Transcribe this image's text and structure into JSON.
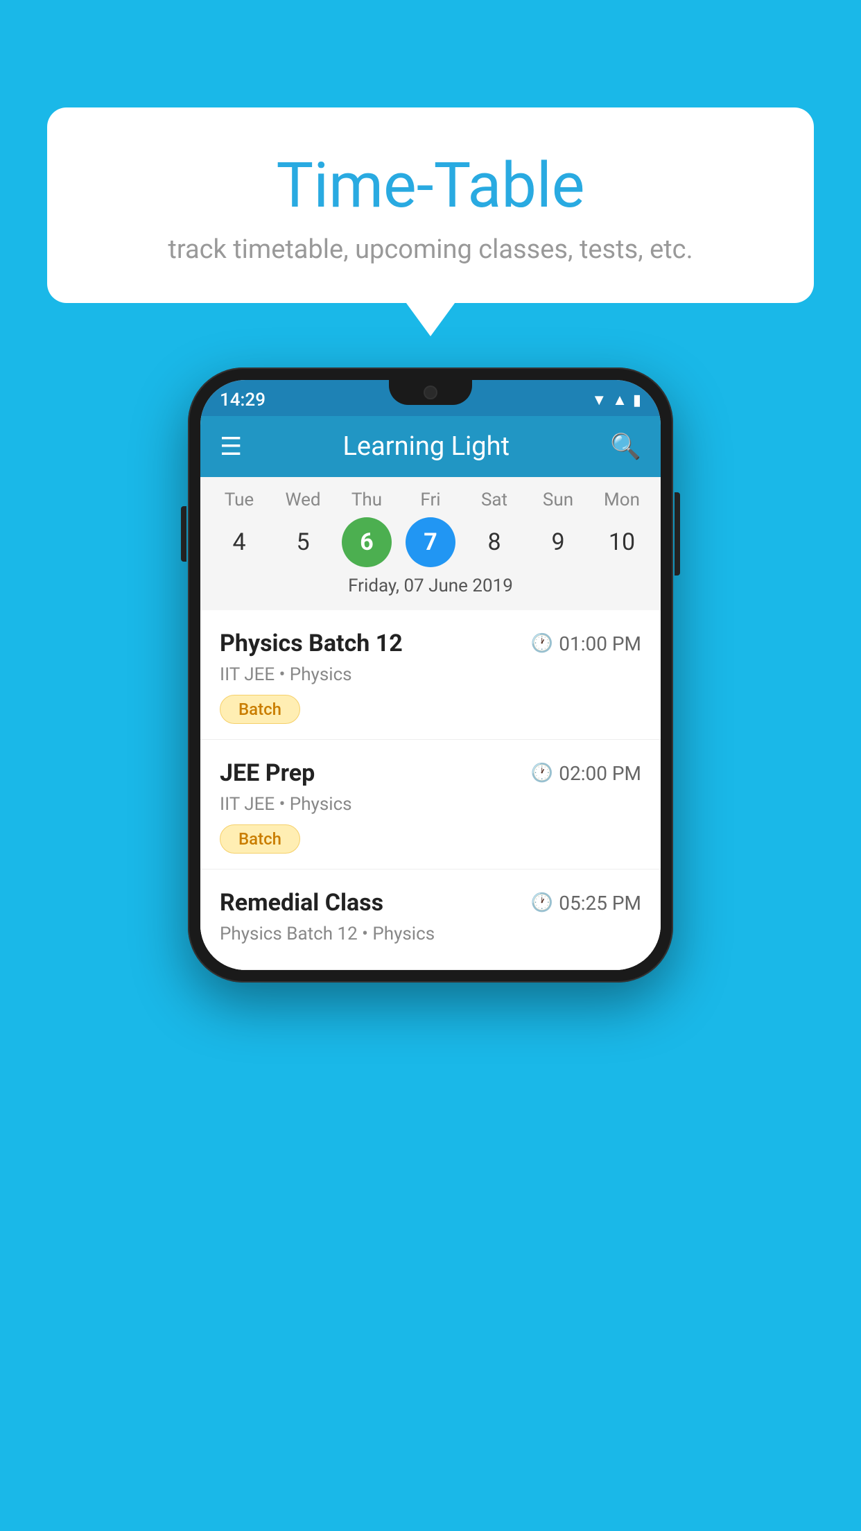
{
  "background": {
    "color": "#1ab8e8"
  },
  "speech_bubble": {
    "title": "Time-Table",
    "subtitle": "track timetable, upcoming classes, tests, etc."
  },
  "phone": {
    "status_bar": {
      "time": "14:29"
    },
    "app_bar": {
      "title": "Learning Light"
    },
    "calendar": {
      "days": [
        {
          "label": "Tue",
          "number": "4"
        },
        {
          "label": "Wed",
          "number": "5"
        },
        {
          "label": "Thu",
          "number": "6",
          "state": "today"
        },
        {
          "label": "Fri",
          "number": "7",
          "state": "selected"
        },
        {
          "label": "Sat",
          "number": "8"
        },
        {
          "label": "Sun",
          "number": "9"
        },
        {
          "label": "Mon",
          "number": "10"
        }
      ],
      "selected_date": "Friday, 07 June 2019"
    },
    "schedule": [
      {
        "title": "Physics Batch 12",
        "time": "01:00 PM",
        "subtitle": "IIT JEE • Physics",
        "tag": "Batch"
      },
      {
        "title": "JEE Prep",
        "time": "02:00 PM",
        "subtitle": "IIT JEE • Physics",
        "tag": "Batch"
      },
      {
        "title": "Remedial Class",
        "time": "05:25 PM",
        "subtitle": "Physics Batch 12 • Physics",
        "tag": ""
      }
    ]
  }
}
